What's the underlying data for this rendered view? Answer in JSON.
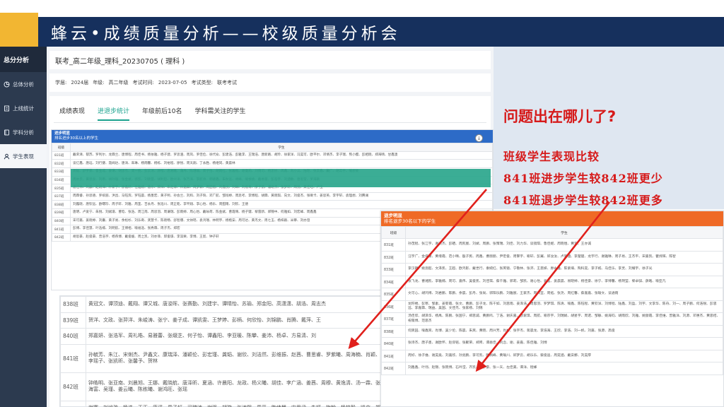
{
  "slide": {
    "title": "蜂云•成绩质量分析——校级质量分析会",
    "question": "问题出在哪儿了?",
    "notes": [
      "班级学生表现比较",
      "841班进步学生较842班更少",
      "841班退步学生较842班更多"
    ],
    "accent_color": "#d61a1a"
  },
  "sidebar": {
    "header": "总分分析",
    "items": [
      {
        "label": "总体分析",
        "icon": "chart-icon"
      },
      {
        "label": "上线统计",
        "icon": "document-icon"
      },
      {
        "label": "学科分析",
        "icon": "book-icon"
      },
      {
        "label": "学生表现",
        "icon": "user-icon"
      }
    ]
  },
  "app": {
    "breadcrumb": "联考_高二年级_理科_20230705 ( 理科 )",
    "info": {
      "school_label": "学届:",
      "school_value": "2024届",
      "grade_label": "年级:",
      "grade_value": "高二年级",
      "time_label": "考试时间:",
      "time_value": "2023-07-05",
      "type_label": "考试类型:",
      "type_value": "联考考试"
    },
    "tabs": [
      "成绩表现",
      "进退步统计",
      "年级前后10名",
      "学科需关注的学生"
    ]
  },
  "table_progress": {
    "title": "进步明显",
    "subtitle": "排名进步30名以上的学生",
    "col_class": "班级",
    "col_students": "学生",
    "rows": [
      {
        "class": "831班",
        "students": "戴荣清、郁苏、罗利尔、龙霖兰、唐博程、周佳书、杨依雅、杨子建、罗思涵、周凤、罗佳俭、徐代俞、彭建浩、彭雅李、王瑞浩、唐新路、胡玲、徐家洋、冯昊可、欧平尔、邓倩杰、李子瑞、熊小樱、彭相晓、郑海晴、甘鑫澳"
      },
      {
        "class": "832班",
        "students": "谈亿鑫、唐珏、刘行健、聂闻达、唐涛、朱琳、杨雨馨、杨栋、刘裕程、廖悦、周天翔、丁永胜、杨继同、黄晨林"
      },
      {
        "class": "833班",
        "students": "龚毅、舒宇豪、鲁金成、姜琳、胡思杰、周一帆、彭云涛、颜楷、唐湘雅、蒲丹、陈瑾瑜、周子怡、胡雨红、张雅楷、谢曼莉、刘雨可、杨思妙、周鑫、刘小瓜、陆瑶、张云鑫、戴广、胡丰宇、喻想姿"
      },
      {
        "class": "834班",
        "students": "周依云、黄思良、刘雨、胡孙璇、张金斌、郭凯、刘晓亚、胡利哲、欧兴洋、张万涛、李航诗、明德鑫、朱秋远、胡峰、喻根桃、戴易蓉、彭浩宇、刘涵敏、唐思莹、罗海颖"
      },
      {
        "class": "835班",
        "students": "唐江林、刘晨、赵刚洋、朴新宇、廖鑫轩、任雅婉、唐乐、郭帅、朱浩博、林嘉卿、周梦颖、周喆楷、刘鑫悦、刘琳、刘楷菁、廖子航、潘晓杰、张梦轩、周悦、黄佳旺、卢玉"
      },
      {
        "class": "837班",
        "students": "周霖睿、孙思德、罗缤丽、洪昌、马钰宾、罗钰晨、杨墨宏、黄子熙、孙会兰、刘和、刘子琦、邓广航、邹闯婷、周思考、李博程、胡霖、黄晓琪、向文、刘俊杰、张喇卡、姜思英、李宇轩、袁理想、刘腾澜"
      },
      {
        "class": "838班",
        "students": "刘露晓、唐钦远、欧曙珍、周子轩、刘雅、周圣、吉永丹、张浩川、周正乾、李平翔、李心怡、杨乐、周甜雨、刘钦、王德"
      },
      {
        "class": "839班",
        "students": "唐明、卢爱宁、朱锐、刘斌璟、曹晗、张浩、周江南、周思羽、周谦瑞、彭雨婷、周心怡、戴咏荷、陈金斌、曹霞晴、杨子键、黎雷新、郑锦中、何雅如、刘宏峰、周鑫鑫"
      },
      {
        "class": "840班",
        "students": "宋可嘉、姜晓婷、刘囊、黄子易、余松杉、刘乐奇、龚慧卡、陈晓畅、舒智爆、文帅瑶、袁鸿瑞、林明宇、杨楷安、周可达、黄杰文、周七玉、杨梓跟、米攀、刘亦澄"
      },
      {
        "class": "841班",
        "students": "彭博、李佳慧、叶浩楠、刘明航、王博桓、喻福浩、张秀霖、周子杰、郑宏"
      },
      {
        "class": "842班",
        "students": "胡思豪、赵俊豪、曾浩宇、杨燕博、戴俊媛、周之凯、刘亦菲、邱俊璟、李淇栗、李博、王宸、钟子轩"
      }
    ]
  },
  "table_zoom_progress": {
    "rows": [
      {
        "class": "838班",
        "students": "黄冠文、谭顶迪、戴翔、谭又城、唐浚晖、张赛勤、刘建宇、谭晴怡、苏瑜、郑金阳、高潇潇、胡浩、周志杰"
      },
      {
        "class": "839班",
        "students": "贺洋、文政、张羿洋、朱峻涛、张宁、姜子成、谭凯雯、王梦婷、彭柄、何欣怡、刘锦鹏、肖腾、戴萍、王"
      },
      {
        "class": "840班",
        "students": "郑嘉妍、张浩军、周礼皓、易雅蕾、张缀芝、何子怡、谭鑫阳、李亚暖、陈攀、姜沛、杨卓、方易清、刘"
      },
      {
        "class": "841班",
        "students": "孙毓芳、朱江、宋俐杰、尹鑫文、康瑞泽、潘颖伦、彭宏瑾、龚韬、谢欣、刘洁然、彭维振、赵茜、曹思睿、罗紫曦、周海楠、肖颖、李瑶子、张凯昕、张馨予、贺林"
      },
      {
        "class": "842班",
        "students": "钟皓明、张亚南、刘晨旭、王娜、戴晓航、唐泽昕、夏涵、许晨阳、龙政、杨义曦、胡佳、李广涵、姜茜、周穆、黄逸清、汤一霖、张海富、吴瑾、姜云曦、陈栋曦、谢鸿旺、张瑶"
      },
      {
        "class": "843班",
        "students": "谢赛、刘谧孜、杨浩、王正、唐滔、周子轩、司瑞涛、谢强、胡璇、张涛熙、周平、陶佳慧、宋思涵、朱妍、梅翰、杨梓毅、凯文、郑泓璟、卢昭睿"
      }
    ]
  },
  "table_regress": {
    "title": "退步明显",
    "subtitle": "排名退步30名以下的学生",
    "col_class": "班级",
    "col_students": "学生",
    "rows": [
      {
        "class": "831班",
        "students": "孙茂程、张江宇、谢杰杰、彭硒、周凯宸、刘斌、周鹏、张策瑞、刘佳、刘力华、谈镜琪、鲁佳妮、周晓煜、黄宣、王亦诚"
      },
      {
        "class": "832班",
        "students": "汪宇广、金倍康、黄增霞、范小晴、殷子民、周鑫、曹丽丽、尹宏俊、周擎宇、喻轩、彭翼、邱汝汝、卢思涵、李楚楚、龙宇行、谢雅琳、周子易、王杰平、宋嘉凯、瞿烨辉、陈智"
      },
      {
        "class": "833班",
        "students": "李汉颖、姚澳超、文泽凯、王超、欧鸿影、戴世行、秦婉红、张英镜、宁敬林、张沛、王思妍、廖永雅、陈紫璃、陶科奕、李子嫣、马佳乐、李灵、刘耀宇、徐子光"
      },
      {
        "class": "834班",
        "students": "张飞龙、曹湘凯、李雅楠、周可、嘉伟、吴俊凯、刘佳琪、蔡千雅、郭莉、邹凯、谢心怡、姜莲、姜晨晨、易晓婷、杨佳豪、徐宁、李博馨、杨玥莹、黎卓骐、薛皓、喻亚凡"
      },
      {
        "class": "835班",
        "students": "文可心、胡鸿博、刘君鹏、陈鹏、余晨、彭丹、张尚、郭阳乐鹏、刘雅宸、王家杰、周沛宜、周拓、张尧、周红馨、蔡嘉嘉、张瑜文、谈通雨"
      },
      {
        "class": "836班",
        "students": "龙籽楼、彭寒、邹素、姜婴霞、张文、曹鹏、彭子龙、陈千如、刘思雨、姜泽浩、周思羽、罗梦琪、陈清、喻鑫、陈钰程、黄钦洋、刘博程、陆鑫、刘盈、刘宇、文李华、陈舟、刘一、周子鹏、何浩锐、彭思远、李嘉霖、瑞益、吴国、文佳杰、张家杨、刘锦"
      },
      {
        "class": "837班",
        "students": "汤佳欣、胡泽华、杨禹、陈鹏、张国宁、郑思诚、黄鹏鸣、丁浩、谢庆嘉、欧家琪、周航、喻宗宇、刘瑞娟、胡星宇、周诺、邹静、姚海钧、胡雨欣、刘雅、姚傲霞、李佳维、曾雅洋、刘源、邓惠杰、黄思桔、祝萌博、范思杰"
      },
      {
        "class": "838班",
        "students": "何爽园、喻鑫宾、肖博、吴少伦、陈晨、朱爽、黄晓、周兴芳、肖林、张宇杰、蒋晨龙、李浩海、王欣、李浩、刘一帆、刘嘉、张源、高俊"
      },
      {
        "class": "840班",
        "students": "张诗杰、唐子墨、谢欧怀、赵仰铭、张聚荣、郑胥、谭恩佳、刘念、谢、姜嘉、陈佳雅、刘博"
      },
      {
        "class": "841班",
        "students": "周好、徐子维、谢昊奥、刘嘉欣、孙亮鹏、李可凯、欧佩峰、黄瑜川、邱梦云、胡乐乐、蔡俊迪、周奕涵、戴安娜、刘昊厚"
      },
      {
        "class": "842班",
        "students": "刘鑫鑫、叶翎、赵锦、张晓博、石吟滢、齐凯、罗宇豪、张一天、左佳美、谭洋、程蜂"
      }
    ]
  }
}
